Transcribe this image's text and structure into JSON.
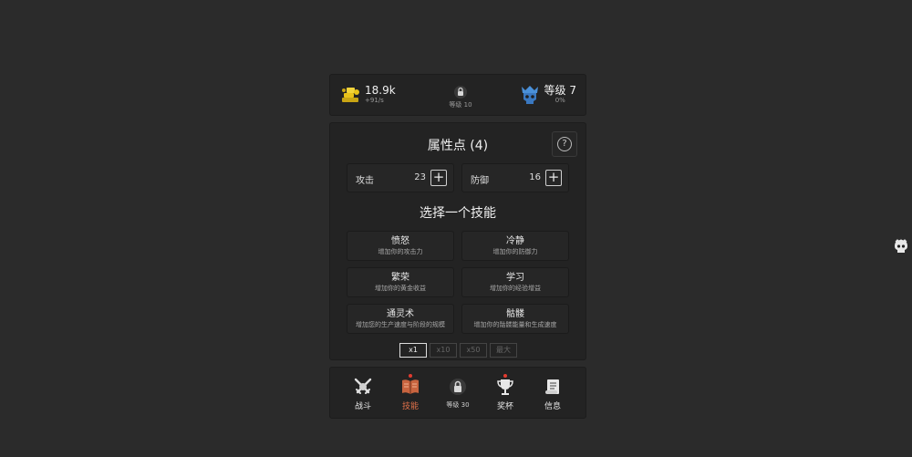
{
  "top": {
    "gold_value": "18.9k",
    "gold_rate": "+91/s",
    "locked_label": "等级 10",
    "rank_label": "等级 7",
    "rank_progress": "0%"
  },
  "attributes": {
    "title": "属性点 (4)",
    "help_symbol": "?",
    "attack_label": "攻击",
    "attack_value": "23",
    "defense_label": "防御",
    "defense_value": "16",
    "plus_symbol": "+"
  },
  "skills": {
    "title": "选择一个技能",
    "items": [
      {
        "name": "愤怒",
        "desc": "增加你的攻击力"
      },
      {
        "name": "冷静",
        "desc": "增加你的防御力"
      },
      {
        "name": "繁荣",
        "desc": "增加你的黄金收益"
      },
      {
        "name": "学习",
        "desc": "增加你的经验增益"
      },
      {
        "name": "通灵术",
        "desc": "增加您的生产速度与阶段的规模"
      },
      {
        "name": "骷髅",
        "desc": "增加你的骷髅能量和生成速度"
      }
    ],
    "multipliers": [
      "x1",
      "x10",
      "x50",
      "最大"
    ],
    "selected_multiplier": "x1"
  },
  "nav": {
    "battle": "战斗",
    "skills": "技能",
    "locked": "等级 30",
    "trophy": "奖杯",
    "info": "信息"
  },
  "colors": {
    "background": "#2b2b2b",
    "panel": "#232323",
    "gold": "#e8c21a",
    "rank_blue": "#4a90d9",
    "active_tab": "#e0714a",
    "notify_dot": "#e23b2f"
  },
  "icons": {
    "gold": "gold-coins-icon",
    "locked": "lock-icon",
    "rank": "crowned-skull-icon",
    "battle": "crossed-swords-icon",
    "skills": "spellbook-icon",
    "trophy": "trophy-icon",
    "info": "scroll-icon",
    "side": "skull-icon"
  }
}
